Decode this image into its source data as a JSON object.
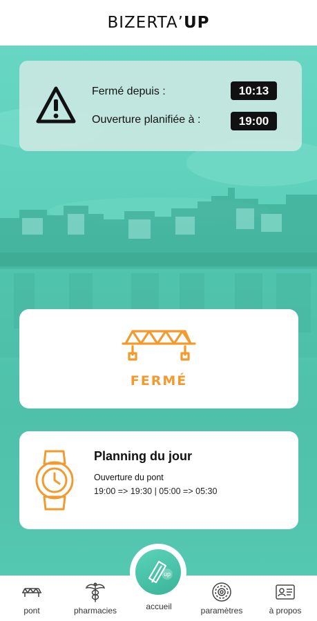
{
  "app": {
    "title_part1": "BIZERTA’",
    "title_part2": "UP"
  },
  "alert": {
    "icon": "warning-icon",
    "closed_since_label": "Fermé depuis :",
    "closed_since_time": "10:13",
    "planned_opening_label": "Ouverture planifiée à :",
    "planned_opening_time": "19:00"
  },
  "bridge_status": {
    "icon": "bridge-icon",
    "label": "FERMÉ",
    "color": "#f29a2e"
  },
  "planning": {
    "icon": "watch-icon",
    "title": "Planning du jour",
    "subtitle": "Ouverture du pont",
    "times": "19:00 => 19:30 | 05:00 => 05:30"
  },
  "nav": {
    "items": [
      {
        "label": "pont",
        "icon": "bridge-nav-icon"
      },
      {
        "label": "pharmacies",
        "icon": "caduceus-icon"
      },
      {
        "label": "accueil",
        "icon": "home-logo-icon"
      },
      {
        "label": "paramètres",
        "icon": "settings-icon"
      },
      {
        "label": "à propos",
        "icon": "id-card-icon"
      }
    ],
    "center_badge": "up"
  },
  "colors": {
    "accent": "#f29a2e",
    "hero_teal": "#55c9b3",
    "text_dark": "#111111"
  }
}
